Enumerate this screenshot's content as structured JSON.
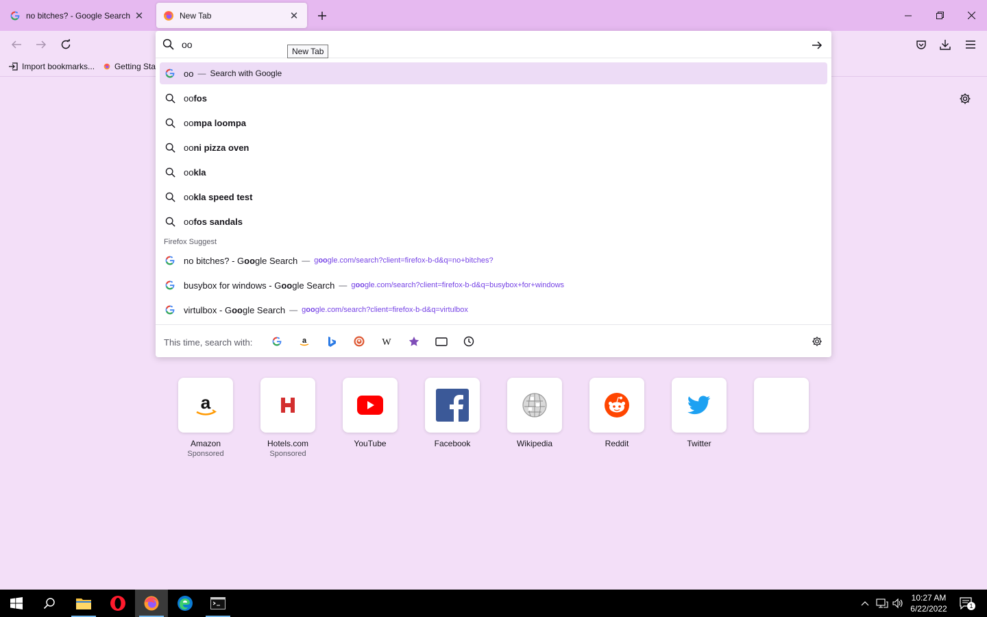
{
  "tabs": [
    {
      "title": "no bitches? - Google Search",
      "active": false,
      "favicon": "google-icon"
    },
    {
      "title": "New Tab",
      "active": true,
      "favicon": "firefox-icon"
    }
  ],
  "bookmarks": [
    {
      "label": "Import bookmarks...",
      "icon": "import-icon"
    },
    {
      "label": "Getting Sta",
      "icon": "firefox-icon"
    }
  ],
  "urlbar": {
    "value": "oo",
    "tooltip": "New Tab",
    "first_result": {
      "typed": "oo",
      "separator": "—",
      "action": "Search with Google"
    },
    "suggestions": [
      {
        "typed": "oo",
        "rest": "fos"
      },
      {
        "typed": "oo",
        "rest": "mpa loompa"
      },
      {
        "typed": "oo",
        "rest": "ni pizza oven"
      },
      {
        "typed": "oo",
        "rest": "kla"
      },
      {
        "typed": "oo",
        "rest": "kla speed test"
      },
      {
        "typed": "oo",
        "rest": "fos sandals"
      }
    ],
    "suggest_header": "Firefox Suggest",
    "history": [
      {
        "title_a": "no bitches? - G",
        "title_b": "oo",
        "title_c": "gle Search",
        "separator": "—",
        "url_a": "g",
        "url_b": "oo",
        "url_c": "gle.com/search?client=firefox-b-d&q=no+bitches?"
      },
      {
        "title_a": "busybox for windows - G",
        "title_b": "oo",
        "title_c": "gle Search",
        "separator": "—",
        "url_a": "g",
        "url_b": "oo",
        "url_c": "gle.com/search?client=firefox-b-d&q=busybox+for+windows"
      },
      {
        "title_a": "virtulbox - G",
        "title_b": "oo",
        "title_c": "gle Search",
        "separator": "—",
        "url_a": "g",
        "url_b": "oo",
        "url_c": "gle.com/search?client=firefox-b-d&q=virtulbox"
      }
    ],
    "oneoff_label": "This time, search with:",
    "engines": [
      "google-icon",
      "amazon-icon",
      "bing-icon",
      "duckduckgo-icon",
      "wikipedia-icon",
      "bookmarks-icon",
      "tabs-icon",
      "history-icon"
    ]
  },
  "top_sites": [
    {
      "label": "Amazon",
      "sub": "Sponsored",
      "icon": "amazon-icon"
    },
    {
      "label": "Hotels.com",
      "sub": "Sponsored",
      "icon": "hotels-icon"
    },
    {
      "label": "YouTube",
      "sub": "",
      "icon": "youtube-icon"
    },
    {
      "label": "Facebook",
      "sub": "",
      "icon": "facebook-icon"
    },
    {
      "label": "Wikipedia",
      "sub": "",
      "icon": "wikipedia-icon"
    },
    {
      "label": "Reddit",
      "sub": "",
      "icon": "reddit-icon"
    },
    {
      "label": "Twitter",
      "sub": "",
      "icon": "twitter-icon"
    },
    {
      "label": "",
      "sub": "",
      "icon": "empty-tile"
    }
  ],
  "clock": {
    "time": "10:27 AM",
    "date": "6/22/2022"
  },
  "notifications_count": "1",
  "colors": {
    "tabstrip": "#e6b9f0",
    "toolbar": "#f3dff8",
    "selected_row": "#eddcf6",
    "url": "#7542e5",
    "taskbar": "#000000"
  }
}
